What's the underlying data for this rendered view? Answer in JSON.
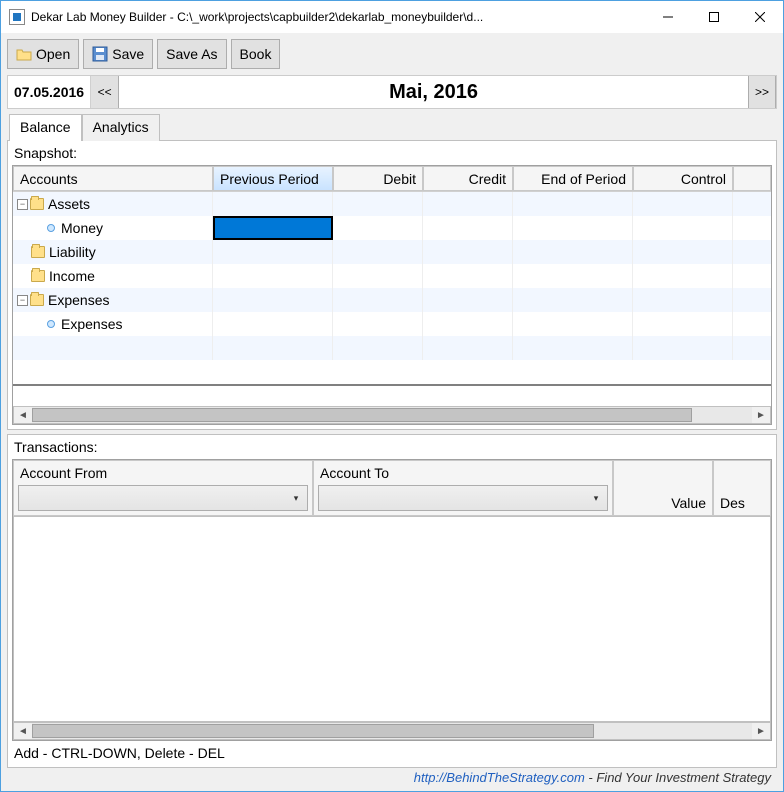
{
  "window": {
    "title": "Dekar Lab Money Builder - C:\\_work\\projects\\capbuilder2\\dekarlab_moneybuilder\\d..."
  },
  "toolbar": {
    "open": "Open",
    "save": "Save",
    "save_as": "Save As",
    "book": "Book"
  },
  "datebar": {
    "date": "07.05.2016",
    "prev": "<<",
    "next": ">>",
    "period": "Mai, 2016"
  },
  "tabs": {
    "balance": "Balance",
    "analytics": "Analytics"
  },
  "snapshot": {
    "label": "Snapshot:",
    "columns": {
      "accounts": "Accounts",
      "previous": "Previous Period",
      "debit": "Debit",
      "credit": "Credit",
      "eop": "End of Period",
      "control": "Control"
    },
    "rows": {
      "assets": "Assets",
      "money": "Money",
      "liability": "Liability",
      "income": "Income",
      "expenses_group": "Expenses",
      "expenses_leaf": "Expenses"
    }
  },
  "transactions": {
    "label": "Transactions:",
    "columns": {
      "from": "Account From",
      "to": "Account To",
      "value": "Value",
      "desc": "Des"
    },
    "hint": "Add - CTRL-DOWN, Delete - DEL"
  },
  "footer": {
    "link": "http://BehindTheStrategy.com",
    "tagline": " - Find Your Investment Strategy"
  }
}
